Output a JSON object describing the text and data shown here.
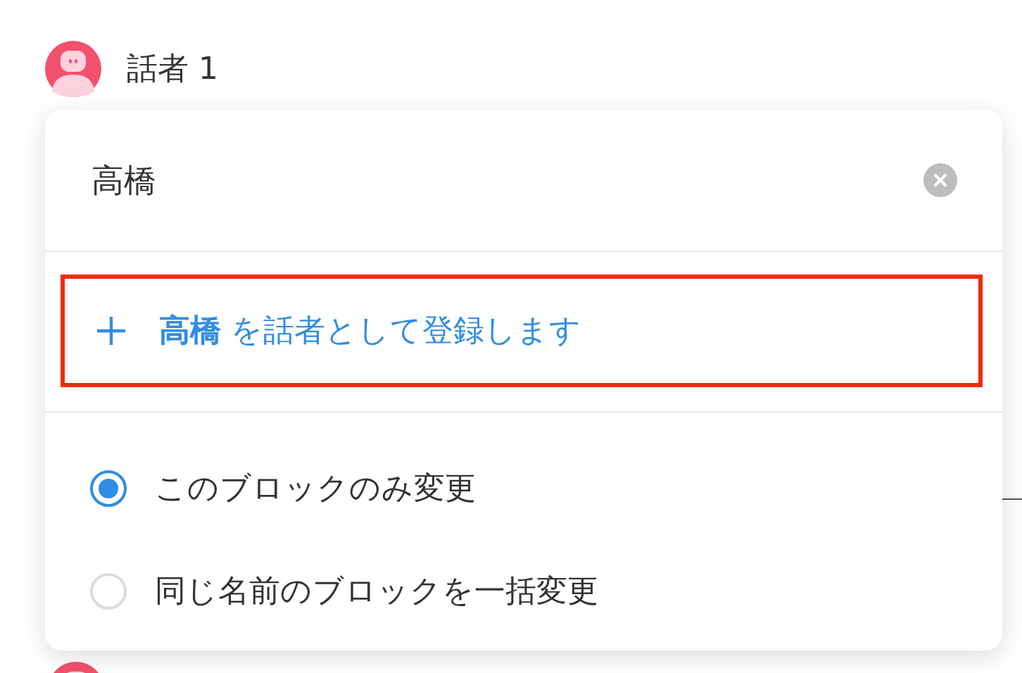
{
  "speaker": {
    "name": "話者 1"
  },
  "popup": {
    "search": {
      "value": "高橋"
    },
    "register": {
      "label": "**高橋** を話者として登録します",
      "highlighted": true
    },
    "options": [
      {
        "label": "このブロックのみ変更",
        "selected": true
      },
      {
        "label": "同じ名前のブロックを一括変更",
        "selected": false
      }
    ]
  }
}
